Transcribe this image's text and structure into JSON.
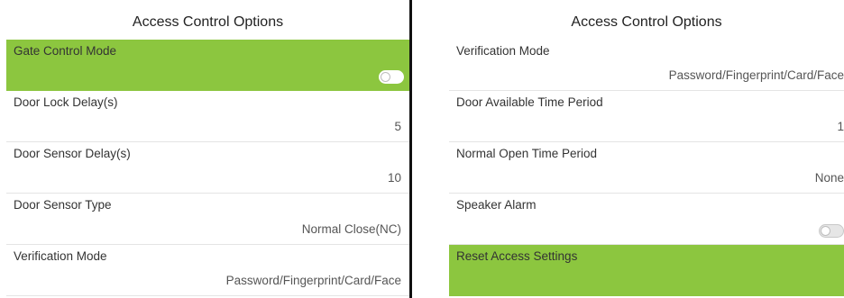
{
  "left": {
    "title": "Access Control Options",
    "rows": [
      {
        "label": "Gate Control Mode",
        "type": "toggle",
        "on": false,
        "highlighted": true
      },
      {
        "label": "Door Lock Delay(s)",
        "value": "5"
      },
      {
        "label": "Door Sensor Delay(s)",
        "value": "10"
      },
      {
        "label": "Door Sensor Type",
        "value": "Normal Close(NC)"
      },
      {
        "label": "Verification Mode",
        "value": "Password/Fingerprint/Card/Face"
      }
    ]
  },
  "right": {
    "title": "Access Control Options",
    "rows": [
      {
        "label": "Verification Mode",
        "value": "Password/Fingerprint/Card/Face"
      },
      {
        "label": "Door Available Time Period",
        "value": "1"
      },
      {
        "label": "Normal Open Time Period",
        "value": "None"
      },
      {
        "label": "Speaker Alarm",
        "type": "toggle",
        "on": false
      },
      {
        "label": "Reset Access Settings",
        "highlighted": true
      }
    ]
  },
  "colors": {
    "highlight": "#8cc63f",
    "divider": "#e4e4e4"
  }
}
